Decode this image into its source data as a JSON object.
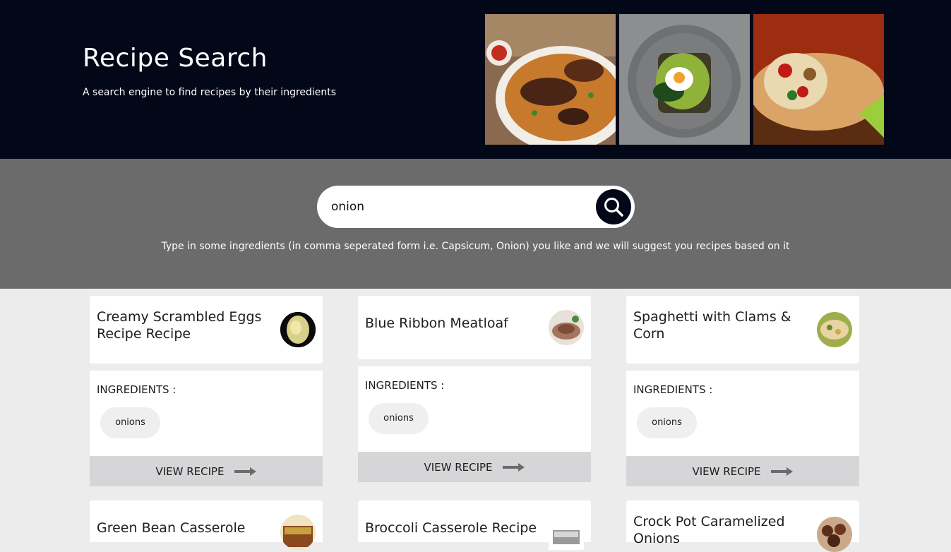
{
  "header": {
    "title": "Recipe Search",
    "subtitle": "A search engine to find recipes by their ingredients"
  },
  "search": {
    "value": "onion",
    "hint": "Type in some ingredients (in comma seperated form i.e. Capsicum, Onion) you like and we will suggest you recipes based on it"
  },
  "labels": {
    "ingredients": "INGREDIENTS :",
    "view_recipe": "VIEW RECIPE"
  },
  "recipes": [
    {
      "title": "Creamy Scrambled Eggs Recipe Recipe",
      "ingredients": [
        "onions"
      ]
    },
    {
      "title": "Blue Ribbon Meatloaf",
      "ingredients": [
        "onions"
      ]
    },
    {
      "title": "Spaghetti with Clams & Corn",
      "ingredients": [
        "onions"
      ]
    },
    {
      "title": "Green Bean Casserole",
      "ingredients": []
    },
    {
      "title": "Broccoli Casserole Recipe",
      "ingredients": []
    },
    {
      "title": "Crock Pot Caramelized Onions",
      "ingredients": []
    }
  ],
  "colors": {
    "header_bg": "#020818",
    "search_band_bg": "#6b6b6b",
    "page_bg": "#ececec",
    "button_bg": "#d6d6d8"
  },
  "icons": {
    "search": "magnifier-icon",
    "view": "arrow-right-icon"
  }
}
